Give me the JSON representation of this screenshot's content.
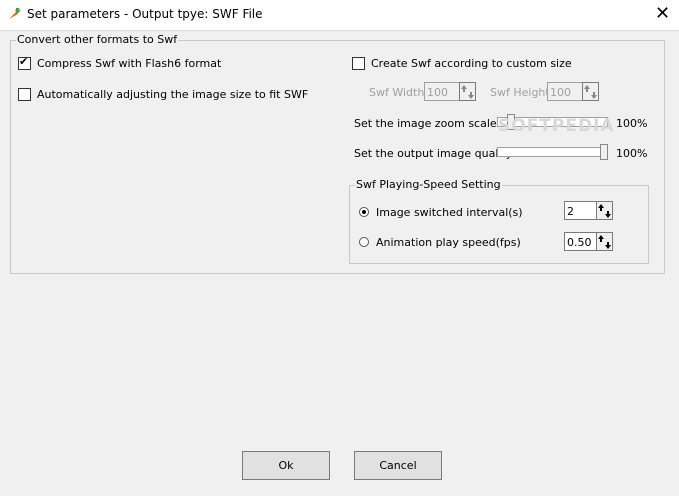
{
  "window": {
    "title": "Set parameters - Output tpye: SWF File",
    "close_glyph": "✕",
    "app_icon": "carrot-app-icon"
  },
  "convert_group": {
    "legend": "Convert other formats to Swf",
    "compress_label": "Compress Swf with Flash6 format",
    "compress_checked": true,
    "auto_adjust_label": "Automatically adjusting the image size to fit SWF",
    "auto_adjust_checked": false,
    "custom_size_label": "Create Swf according to custom size",
    "custom_size_checked": false,
    "swf_width_label": "Swf Width",
    "swf_width_value": "100",
    "swf_height_label": "Swf Height",
    "swf_height_value": "100",
    "zoom_label": "Set the image zoom scale",
    "zoom_value": "100%",
    "zoom_level": 0.1,
    "quality_label": "Set the output image quality",
    "quality_value": "100%",
    "quality_level": 1.0,
    "watermark": "SOFTPEDIA"
  },
  "speed_group": {
    "legend": "Swf Playing-Speed Setting",
    "interval_label": "Image switched interval(s)",
    "interval_value": "2",
    "interval_selected": true,
    "fps_label": "Animation play speed(fps)",
    "fps_value": "0.50",
    "fps_selected": false
  },
  "buttons": {
    "ok_label": "Ok",
    "cancel_label": "Cancel"
  }
}
